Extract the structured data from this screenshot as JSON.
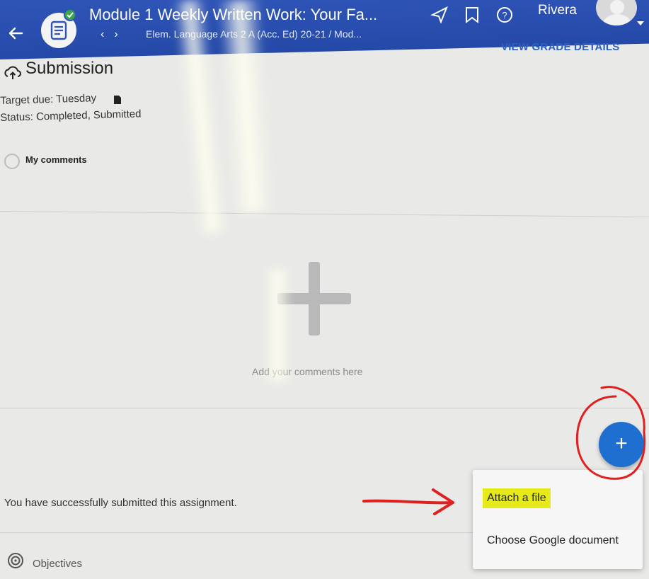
{
  "header": {
    "title": "Module 1 Weekly Written Work: Your Fa...",
    "breadcrumb": "Elem. Language Arts 2 A (Acc. Ed) 20-21 / Mod...",
    "user_name": "Rivera",
    "icons": [
      "back-arrow-icon",
      "assignment-doc-icon",
      "check-badge-icon",
      "send-icon",
      "bookmark-icon",
      "help-icon",
      "avatar-icon"
    ]
  },
  "grade_details_label": "VIEW GRADE DETAILS",
  "submission": {
    "title": "Submission",
    "target_due": "Target due: Tuesday",
    "status": "Status: Completed, Submitted",
    "my_comments_label": "My comments",
    "add_comments_placeholder": "Add your comments here",
    "success_message": "You have successfully submitted this assignment."
  },
  "fab": {
    "label": "+",
    "color": "#1e6fd0"
  },
  "popup_menu": {
    "items": [
      "Attach a file",
      "Choose Google document"
    ],
    "highlight_color": "#e7ea1a"
  },
  "objectives_label": "Objectives",
  "colors": {
    "header": "#2f55b8",
    "link": "#2c61c4",
    "annotation": "#e02020"
  }
}
